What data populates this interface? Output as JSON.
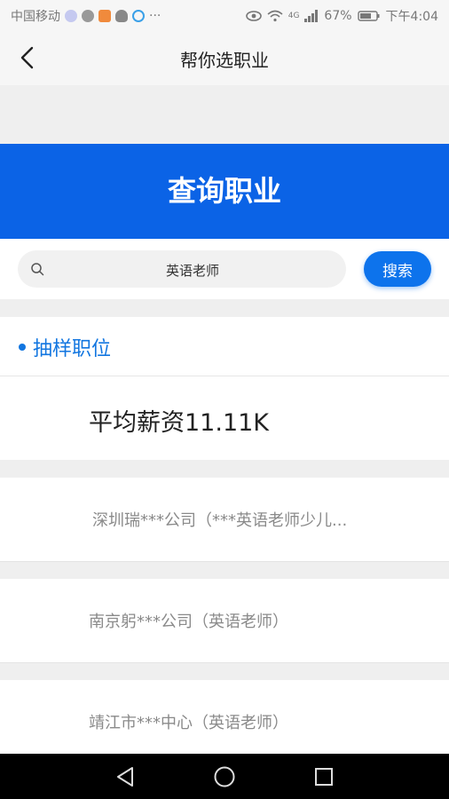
{
  "status_bar": {
    "carrier": "中国移动",
    "more": "···",
    "network": "4G",
    "battery": "67%",
    "time": "下午4:04"
  },
  "navbar": {
    "title": "帮你选职业"
  },
  "banner": {
    "title": "查询职业"
  },
  "search": {
    "value": "英语老师",
    "button_label": "搜索"
  },
  "section": {
    "title": "抽样职位"
  },
  "salary": {
    "text": "平均薪资11.11K"
  },
  "jobs": [
    {
      "text": "深圳瑞***公司（***英语老师少儿..."
    },
    {
      "text": "南京躬***公司（英语老师）"
    },
    {
      "text": "靖江市***中心（英语老师）"
    }
  ],
  "colors": {
    "banner_blue": "#0b63e6",
    "accent_blue": "#1276e0",
    "button_blue": "#0d73ec"
  }
}
